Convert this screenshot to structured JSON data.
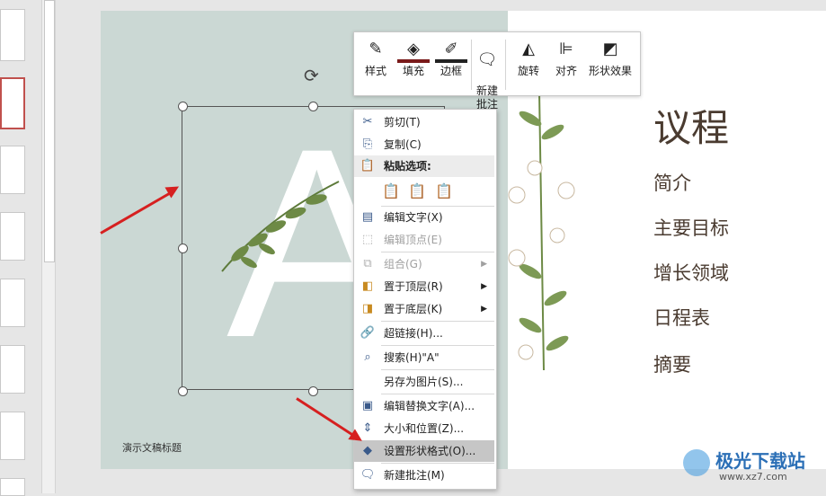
{
  "slide": {
    "big_letter": "A",
    "footer": "演示文稿标题",
    "title": "议程",
    "agenda": [
      "简介",
      "主要目标",
      "增长领域",
      "日程表",
      "摘要"
    ]
  },
  "toolbar": {
    "buttons": [
      {
        "label": "样式",
        "icon": "style-icon"
      },
      {
        "label": "填充",
        "icon": "fill-bucket-icon"
      },
      {
        "label": "边框",
        "icon": "border-pen-icon"
      },
      {
        "label": "新建\n批注",
        "icon": "new-comment-icon"
      },
      {
        "label": "旋转",
        "icon": "rotate-icon"
      },
      {
        "label": "对齐",
        "icon": "align-icon"
      },
      {
        "label": "形状效果",
        "icon": "shape-effects-icon"
      }
    ]
  },
  "context_menu": {
    "cut": "剪切(T)",
    "copy": "复制(C)",
    "paste_header": "粘贴选项:",
    "edit_text": "编辑文字(X)",
    "edit_points": "编辑顶点(E)",
    "group": "组合(G)",
    "bring_front": "置于顶层(R)",
    "send_back": "置于底层(K)",
    "hyperlink": "超链接(H)...",
    "search": "搜索(H)\"A\"",
    "save_as_picture": "另存为图片(S)...",
    "edit_alt_text": "编辑替换文字(A)...",
    "size_position": "大小和位置(Z)...",
    "format_shape": "设置形状格式(O)...",
    "new_comment": "新建批注(M)"
  },
  "watermark": {
    "brand": "极光下载站",
    "url": "www.xz7.com"
  }
}
